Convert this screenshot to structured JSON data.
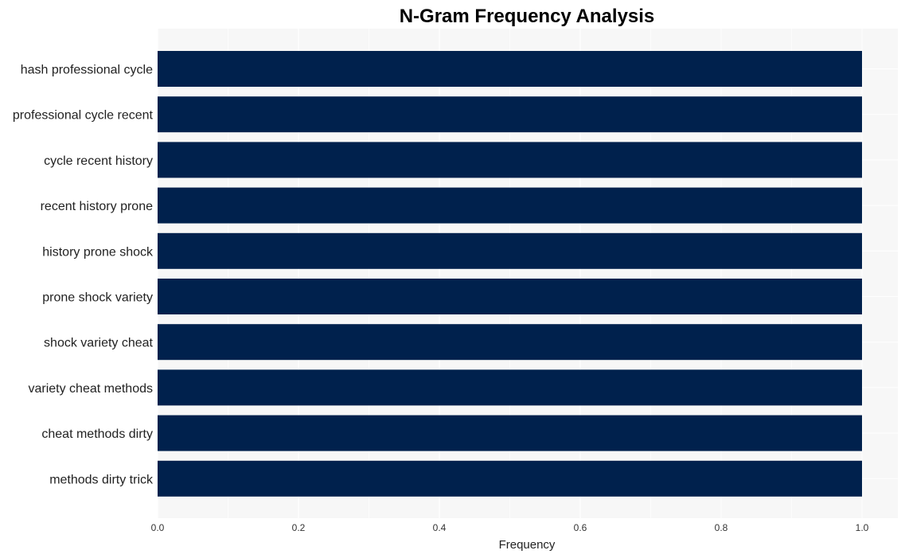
{
  "chart_data": {
    "type": "bar",
    "orientation": "horizontal",
    "title": "N-Gram Frequency Analysis",
    "xlabel": "Frequency",
    "ylabel": "",
    "xlim": [
      0,
      1.05
    ],
    "xticks": [
      "0.0",
      "0.2",
      "0.4",
      "0.6",
      "0.8",
      "1.0"
    ],
    "grid": true,
    "bar_color": "#00214d",
    "background_color": "#f7f7f7",
    "categories": [
      "hash professional cycle",
      "professional cycle recent",
      "cycle recent history",
      "recent history prone",
      "history prone shock",
      "prone shock variety",
      "shock variety cheat",
      "variety cheat methods",
      "cheat methods dirty",
      "methods dirty trick"
    ],
    "values": [
      1,
      1,
      1,
      1,
      1,
      1,
      1,
      1,
      1,
      1
    ]
  }
}
